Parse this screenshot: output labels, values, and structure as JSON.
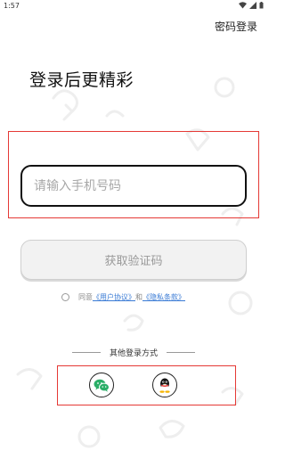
{
  "status_bar": {
    "time": "1:57",
    "icons": [
      "wifi-icon",
      "signal-icon",
      "battery-icon"
    ]
  },
  "header": {
    "password_login_label": "密码登录"
  },
  "main": {
    "title": "登录后更精彩",
    "phone_input": {
      "placeholder": "请输入手机号码",
      "value": ""
    },
    "get_code_label": "获取验证码"
  },
  "agreement": {
    "prefix": "同意",
    "user_agreement": "《用户协议》",
    "conjunction": "和",
    "privacy_policy": "《隐私条款》",
    "checked": false
  },
  "other_login": {
    "label": "其他登录方式",
    "options": [
      "wechat-icon",
      "qq-icon"
    ]
  },
  "colors": {
    "highlight": "#e53935",
    "link": "#3a7bd5",
    "input_border": "#111111",
    "button_bg": "#f2f2f2",
    "button_text": "#9a9a9a"
  }
}
